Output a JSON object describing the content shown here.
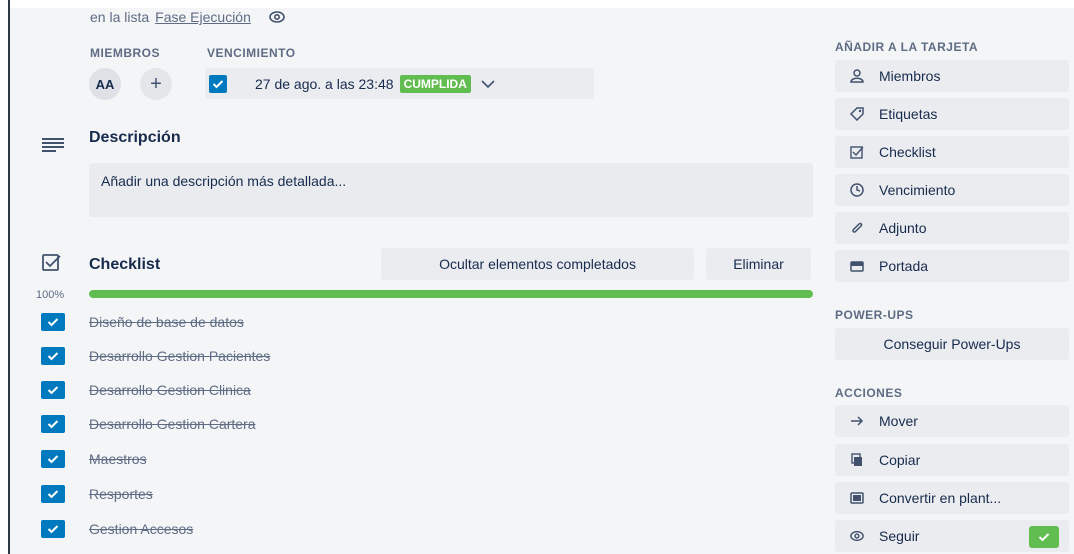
{
  "header": {
    "in_list_prefix": "en la lista",
    "list_name": "Fase Ejecución"
  },
  "members": {
    "label": "MIEMBROS",
    "avatar_initials": "AA",
    "add_symbol": "+"
  },
  "due": {
    "label": "VENCIMIENTO",
    "date_text": "27 de ago. a las 23:48",
    "status_badge": "CUMPLIDA",
    "checked": true
  },
  "description": {
    "title": "Descripción",
    "placeholder": "Añadir una descripción más detallada..."
  },
  "checklist": {
    "title": "Checklist",
    "hide_completed_label": "Ocultar elementos completados",
    "delete_label": "Eliminar",
    "progress_text": "100%",
    "progress_fraction": 1.0,
    "items": [
      {
        "text": "Diseño de base de datos",
        "checked": true
      },
      {
        "text": "Desarrollo Gestion Pacientes",
        "checked": true
      },
      {
        "text": "Desarrollo Gestion Clinica",
        "checked": true
      },
      {
        "text": "Desarrollo Gestion Cartera",
        "checked": true
      },
      {
        "text": "Maestros",
        "checked": true
      },
      {
        "text": "Resportes",
        "checked": true
      },
      {
        "text": "Gestion Accesos",
        "checked": true
      }
    ]
  },
  "sidebar": {
    "add_to_card_title": "AÑADIR A LA TARJETA",
    "add_to_card": [
      {
        "label": "Miembros",
        "icon": "person-icon"
      },
      {
        "label": "Etiquetas",
        "icon": "tag-icon"
      },
      {
        "label": "Checklist",
        "icon": "checklist-icon"
      },
      {
        "label": "Vencimiento",
        "icon": "clock-icon"
      },
      {
        "label": "Adjunto",
        "icon": "paperclip-icon"
      },
      {
        "label": "Portada",
        "icon": "cover-icon"
      }
    ],
    "powerups_title": "POWER-UPS",
    "get_powerups_label": "Conseguir Power-Ups",
    "actions_title": "ACCIONES",
    "actions": [
      {
        "label": "Mover",
        "icon": "arrow-right-icon"
      },
      {
        "label": "Copiar",
        "icon": "copy-icon"
      },
      {
        "label": "Convertir en plant...",
        "icon": "template-icon"
      },
      {
        "label": "Seguir",
        "icon": "eye-icon"
      }
    ]
  },
  "colors": {
    "accent_blue": "#0079bf",
    "success_green": "#61bd4f",
    "button_gray": "#ebecf0",
    "text_dark": "#172b4d",
    "text_muted": "#5e6c84"
  }
}
